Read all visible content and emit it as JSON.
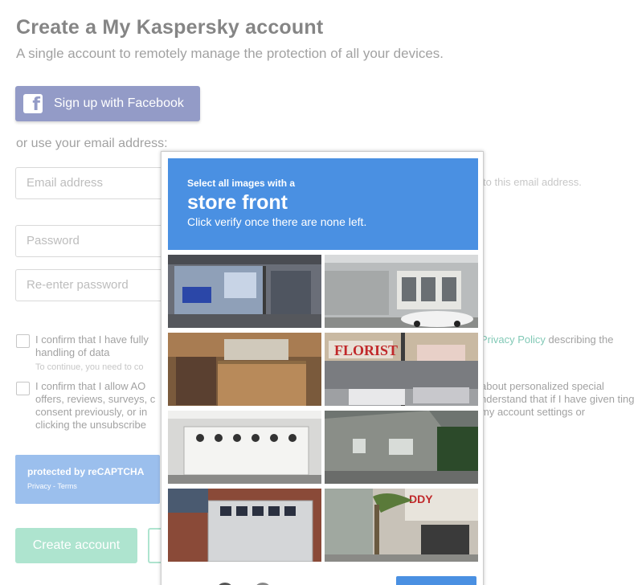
{
  "page": {
    "title": "Create a My Kaspersky account",
    "subtitle": "A single account to remotely manage the protection of all your devices.",
    "facebook_button": "Sign up with Facebook",
    "or_text": "or use your email address:",
    "email_placeholder": "Email address",
    "email_hint": "to this email address.",
    "password_placeholder": "Password",
    "reenter_placeholder": "Re-enter password",
    "consent1_line1": "I confirm that I have fully",
    "consent1_line2": "handling of data",
    "consent1_right_link": "Privacy Policy",
    "consent1_right_text": " describing the",
    "consent_hint": "To continue, you need to co",
    "consent2_lines": [
      "I confirm that I allow AO",
      "offers, reviews, surveys, c",
      "consent previously, or in",
      "clicking the unsubscribe"
    ],
    "consent2_right": "about personalized special nderstand that if I have given ting my account settings or",
    "recaptcha_badge_title": "protected by reCAPTCHA",
    "recaptcha_badge_links": "Privacy - Terms",
    "create_button": "Create account"
  },
  "challenge": {
    "header_small": "Select all images with a",
    "header_big": "store front",
    "header_instruction": "Click verify once there are none left.",
    "tiles": [
      "storefront-window",
      "white-building-car",
      "wooden-fence",
      "florist-shop",
      "garage-door",
      "gray-house",
      "brick-garage",
      "palm-shop"
    ]
  },
  "colors": {
    "challenge_blue": "#4a90e2",
    "facebook_blue": "#3b4a9a",
    "create_green": "#6ccfa9",
    "link_green": "#1a9c7a"
  }
}
